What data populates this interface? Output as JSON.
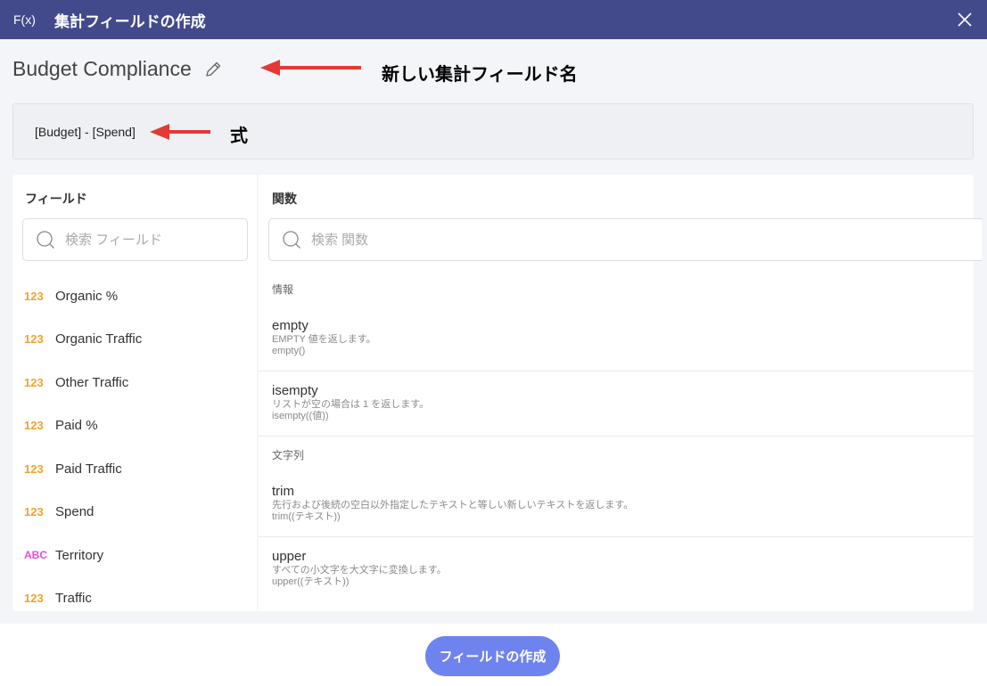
{
  "window": {
    "fx_label": "F(x)",
    "title": "集計フィールドの作成",
    "close_icon": "close-icon"
  },
  "field": {
    "name": "Budget Compliance",
    "edit_icon": "pencil-icon"
  },
  "formula": {
    "expression": "[Budget] - [Spend]"
  },
  "annotations": {
    "name_label": "新しい集計フィールド名",
    "formula_label": "式",
    "arrow_color": "#e53935"
  },
  "fields_panel": {
    "header": "フィールド",
    "search_placeholder": "検索 フィールド",
    "items": [
      {
        "type": "123",
        "label": "Organic %"
      },
      {
        "type": "123",
        "label": "Organic Traffic"
      },
      {
        "type": "123",
        "label": "Other Traffic"
      },
      {
        "type": "123",
        "label": "Paid %"
      },
      {
        "type": "123",
        "label": "Paid Traffic"
      },
      {
        "type": "123",
        "label": "Spend"
      },
      {
        "type": "ABC",
        "label": "Territory"
      },
      {
        "type": "123",
        "label": "Traffic"
      }
    ]
  },
  "functions_panel": {
    "header": "関数",
    "search_placeholder": "検索 関数",
    "groups": [
      {
        "category": "情報",
        "functions": [
          {
            "name": "empty",
            "description": "EMPTY 値を返します。",
            "syntax": "empty()"
          },
          {
            "name": "isempty",
            "description": "リストが空の場合は 1 を返します。",
            "syntax": "isempty((値))"
          }
        ]
      },
      {
        "category": "文字列",
        "functions": [
          {
            "name": "trim",
            "description": "先行および後続の空白以外指定したテキストと等しい新しいテキストを返します。",
            "syntax": "trim((テキスト))"
          },
          {
            "name": "upper",
            "description": "すべての小文字を大文字に変換します。",
            "syntax": "upper((テキスト))"
          }
        ]
      }
    ]
  },
  "footer": {
    "create_button": "フィールドの作成"
  },
  "colors": {
    "titlebar": "#434a8c",
    "accent_button": "#6f83ef",
    "number_type": "#f3a12c",
    "text_type": "#e34ce0"
  }
}
